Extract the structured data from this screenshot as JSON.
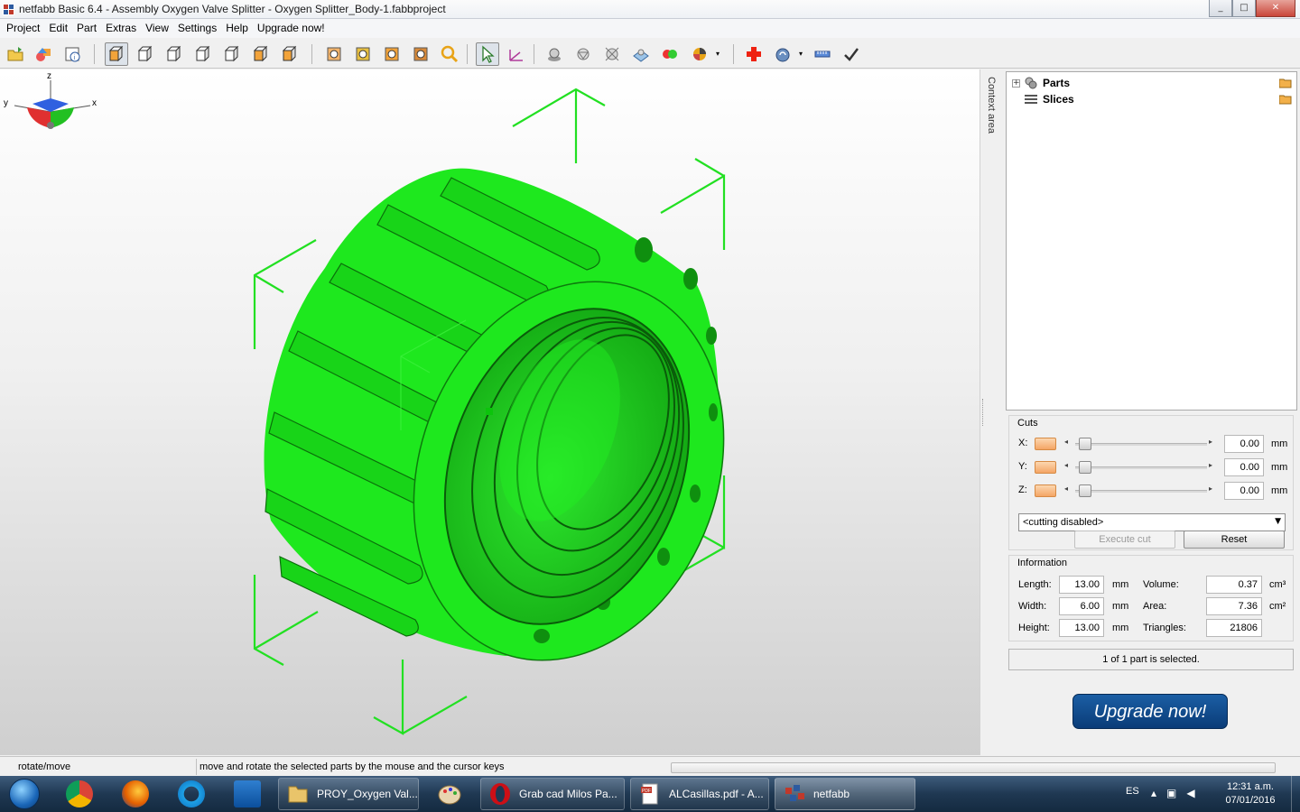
{
  "window": {
    "title": "netfabb Basic 6.4 - Assembly Oxygen Valve Splitter - Oxygen Splitter_Body-1.fabbproject",
    "minimize": "_",
    "maximize": "□",
    "close": "✕"
  },
  "menu": [
    "Project",
    "Edit",
    "Part",
    "Extras",
    "View",
    "Settings",
    "Help",
    "Upgrade now!"
  ],
  "toolbar": {
    "active_tools": [
      "view-3d-icon",
      "select-pointer-icon"
    ],
    "icons": [
      "open-project-icon",
      "add-part-icon",
      "part-info-icon",
      "view-3d-icon",
      "view-front-icon",
      "view-back-icon",
      "view-left-icon",
      "view-right-icon",
      "view-top-icon",
      "view-bottom-icon",
      "zoom-parts-icon",
      "zoom-selected-icon",
      "zoom-all-icon",
      "zoom-platform-icon",
      "zoom-icon",
      "select-pointer-icon",
      "measure-icon",
      "shading-icon",
      "triangle-mode-icon",
      "axes-mode-icon",
      "platform-mode-icon",
      "color-mode-icon",
      "pie-chart-icon",
      "repair-icon",
      "analysis-icon",
      "ruler-icon",
      "apply-check-icon"
    ]
  },
  "colors": {
    "model_green": "#1ee81e",
    "accent_orange": "#f4a565",
    "upgrade_blue": "#0f4a8c"
  },
  "viewport": {
    "axis_labels": {
      "x": "x",
      "y": "y",
      "z": "z"
    }
  },
  "context_tab": {
    "label": "Context area"
  },
  "tree": {
    "items": [
      {
        "label": "Parts",
        "icon": "parts-icon",
        "expander": "+"
      },
      {
        "label": "Slices",
        "icon": "slices-icon",
        "expander": ""
      }
    ]
  },
  "cuts": {
    "title": "Cuts",
    "rows": [
      {
        "axis": "X:",
        "value": "0.00",
        "unit": "mm"
      },
      {
        "axis": "Y:",
        "value": "0.00",
        "unit": "mm"
      },
      {
        "axis": "Z:",
        "value": "0.00",
        "unit": "mm"
      }
    ],
    "mode": "<cutting disabled>",
    "execute_label": "Execute cut",
    "reset_label": "Reset"
  },
  "information": {
    "title": "Information",
    "length_label": "Length:",
    "length": "13.00",
    "length_unit": "mm",
    "width_label": "Width:",
    "width": "6.00",
    "width_unit": "mm",
    "height_label": "Height:",
    "height": "13.00",
    "height_unit": "mm",
    "volume_label": "Volume:",
    "volume": "0.37",
    "volume_unit": "cm³",
    "area_label": "Area:",
    "area": "7.36",
    "area_unit": "cm²",
    "triangles_label": "Triangles:",
    "triangles": "21806"
  },
  "selection_status": "1 of 1 part is selected.",
  "upgrade_button": "Upgrade now!",
  "statusbar": {
    "mode": "rotate/move",
    "hint": "move and rotate the selected parts by the mouse and the cursor keys"
  },
  "taskbar": {
    "tasks": [
      {
        "label": "PROY_Oxygen Val...",
        "icon": "folder-icon"
      },
      {
        "label": "Grab cad Milos Pa...",
        "icon": "opera-icon"
      },
      {
        "label": "ALCasillas.pdf - A...",
        "icon": "pdf-icon"
      },
      {
        "label": "netfabb",
        "icon": "netfabb-icon"
      }
    ],
    "language": "ES",
    "time": "12:31 a.m.",
    "date": "07/01/2016"
  }
}
